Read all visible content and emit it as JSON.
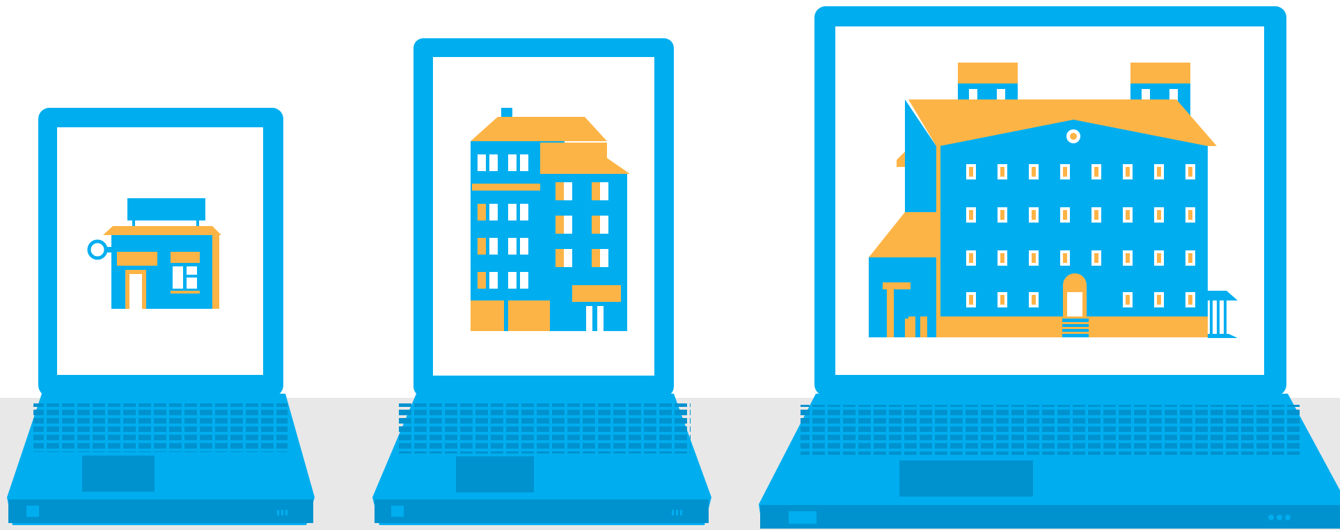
{
  "palette": {
    "background": "#ffffff",
    "desk": "#e8e8e8",
    "device_blue": "#00aeef",
    "device_dark": "#0092cf",
    "key_shade": "#008fca",
    "screen": "#ffffff",
    "building_blue": "#00aeef",
    "building_accent": "#fdb446"
  },
  "scene": {
    "devices": [
      {
        "id": "small-laptop",
        "contents": "shop-building-icon"
      },
      {
        "id": "medium-laptop",
        "contents": "apartment-building-icon"
      },
      {
        "id": "large-laptop",
        "contents": "large-office-building-icon"
      }
    ]
  }
}
